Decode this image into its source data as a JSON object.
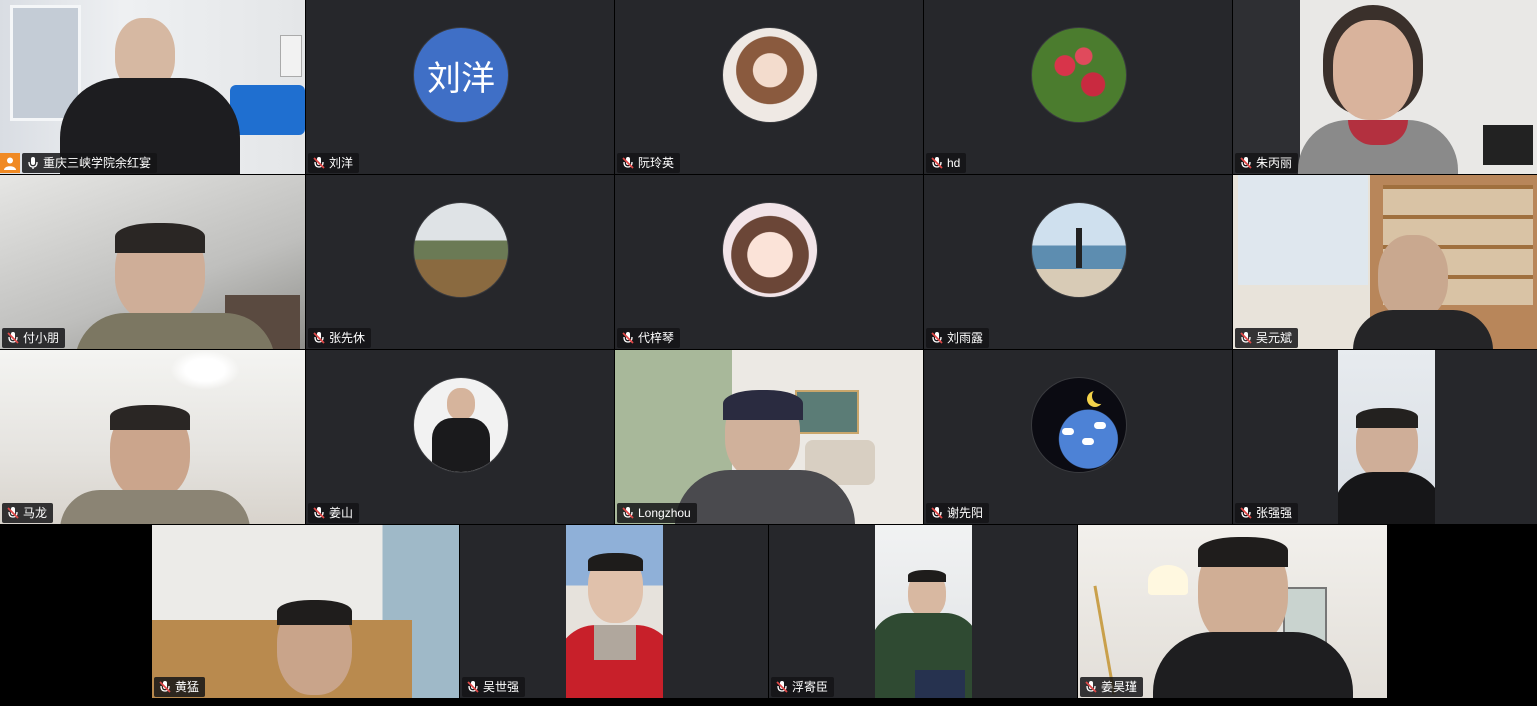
{
  "participants": [
    {
      "name": "重庆三峡学院余红宴",
      "host": true,
      "camera": true,
      "scene": "room-white"
    },
    {
      "name": "刘洋",
      "camera": false,
      "avatar_text": "刘洋",
      "avatar_color": "#3f6fc6"
    },
    {
      "name": "阮玲英",
      "camera": false,
      "avatar": "girl-photo"
    },
    {
      "name": "hd",
      "camera": false,
      "avatar": "flowers-photo"
    },
    {
      "name": "朱丙丽",
      "camera": true,
      "scene": "woman-room"
    },
    {
      "name": "付小朋",
      "camera": true,
      "scene": "room-grey"
    },
    {
      "name": "张先休",
      "camera": false,
      "avatar": "mountain-photo"
    },
    {
      "name": "代梓琴",
      "camera": false,
      "avatar": "cartoon-girl"
    },
    {
      "name": "刘雨露",
      "camera": false,
      "avatar": "seaside-photo"
    },
    {
      "name": "吴元斌",
      "camera": true,
      "scene": "bookshelf-room"
    },
    {
      "name": "马龙",
      "camera": true,
      "scene": "room-light"
    },
    {
      "name": "姜山",
      "camera": false,
      "avatar": "man-suit-photo"
    },
    {
      "name": "Longzhou",
      "camera": true,
      "scene": "virtual-living-room"
    },
    {
      "name": "谢先阳",
      "camera": false,
      "avatar": "sheep-art"
    },
    {
      "name": "张强强",
      "camera": true,
      "scene": "portrait-phone"
    },
    {
      "name": "黄猛",
      "camera": true,
      "scene": "dorm-room"
    },
    {
      "name": "吴世强",
      "camera": true,
      "scene": "portrait-red-jacket"
    },
    {
      "name": "浮寄臣",
      "camera": true,
      "scene": "portrait-green-jacket"
    },
    {
      "name": "姜昊瑾",
      "camera": true,
      "scene": "room-lamp"
    }
  ],
  "icons": {
    "muted_mic": "mic-muted-icon",
    "host": "host-person-icon",
    "active_mic": "mic-icon"
  },
  "colors": {
    "background": "#000000",
    "tile": "#26272b",
    "label_bg": "#141416",
    "host_badge": "#f08a24",
    "mute_red": "#e04848"
  }
}
